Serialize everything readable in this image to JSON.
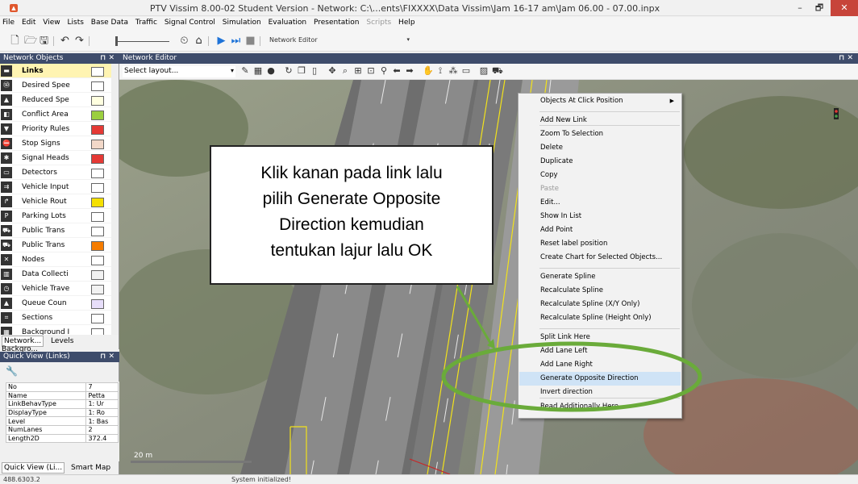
{
  "window": {
    "title": "PTV Vissim 8.00-02 Student Version - Network: C:\\...ents\\FIXXXX\\Data Vissim\\Jam 16-17 am\\Jam 06.00 - 07.00.inpx",
    "app_icon": "vissim-logo-icon",
    "minimize": "–",
    "maximize": "🗗",
    "close": "✕"
  },
  "menubar": {
    "items": [
      "File",
      "Edit",
      "View",
      "Lists",
      "Base Data",
      "Traffic",
      "Signal Control",
      "Simulation",
      "Evaluation",
      "Presentation",
      "Scripts",
      "Help"
    ]
  },
  "toolbar": {
    "editor_select": "Network Editor",
    "caret": "▾"
  },
  "network_objects": {
    "title": "Network Objects",
    "controls": "⊓ ✕",
    "colors": {
      "selected_row": "#fff4b2"
    },
    "items": [
      {
        "label": "Links",
        "bold": true,
        "swatch": "#ffffff"
      },
      {
        "label": "Desired Spee",
        "bold": false,
        "swatch": "#ffffff"
      },
      {
        "label": "Reduced Spe",
        "bold": false,
        "swatch": "#ffffe0"
      },
      {
        "label": "Conflict Area",
        "bold": false,
        "swatch": "#9bcf3f"
      },
      {
        "label": "Priority Rules",
        "bold": false,
        "swatch": "#e53935"
      },
      {
        "label": "Stop Signs",
        "bold": false,
        "swatch": "#f2d8c8"
      },
      {
        "label": "Signal Heads",
        "bold": false,
        "swatch": "#e53935"
      },
      {
        "label": "Detectors",
        "bold": false,
        "swatch": "#ffffff"
      },
      {
        "label": "Vehicle Input",
        "bold": false,
        "swatch": "#ffffff"
      },
      {
        "label": "Vehicle Rout",
        "bold": false,
        "swatch": "#f5e000"
      },
      {
        "label": "Parking Lots",
        "bold": false,
        "swatch": "#ffffff"
      },
      {
        "label": "Public Trans",
        "bold": false,
        "swatch": "#ffffff"
      },
      {
        "label": "Public Trans",
        "bold": false,
        "swatch": "#f57c00"
      },
      {
        "label": "Nodes",
        "bold": false,
        "swatch": "#ffffff"
      },
      {
        "label": "Data Collecti",
        "bold": false,
        "swatch": "#f2f2f2"
      },
      {
        "label": "Vehicle Trave",
        "bold": false,
        "swatch": "#f2f2f2"
      },
      {
        "label": "Queue Coun",
        "bold": false,
        "swatch": "#e7defa"
      },
      {
        "label": "Sections",
        "bold": false,
        "swatch": "#ffffff"
      },
      {
        "label": "Background I",
        "bold": false,
        "swatch": "#ffffff"
      }
    ],
    "tabs": [
      "Network...",
      "Levels",
      "Backgro..."
    ]
  },
  "quick_view": {
    "title": "Quick View (Links)",
    "controls": "⊓ ✕",
    "wrench": "🔧",
    "rows": [
      {
        "key": "No",
        "value": "7"
      },
      {
        "key": "Name",
        "value": "Petta"
      },
      {
        "key": "LinkBehavType",
        "value": "1: Ur"
      },
      {
        "key": "DisplayType",
        "value": "1: Ro"
      },
      {
        "key": "Level",
        "value": "1: Bas"
      },
      {
        "key": "NumLanes",
        "value": "2"
      },
      {
        "key": "Length2D",
        "value": "372.4"
      }
    ],
    "tabs": [
      "Quick View (Li...",
      "Smart Map"
    ]
  },
  "network_editor": {
    "title": "Network Editor",
    "controls": "⊓ ✕",
    "layout_select": "Select layout...",
    "scale_label": "20 m"
  },
  "callout": {
    "lines": [
      "Klik kanan pada link lalu",
      "pilih Generate Opposite",
      "Direction kemudian",
      "tentukan lajur lalu OK"
    ]
  },
  "context_menu": {
    "items": [
      {
        "label": "Objects At Click Position",
        "submenu": true
      },
      {
        "label": "Add New Link"
      },
      {
        "label": "Zoom To Selection"
      },
      {
        "label": "Delete"
      },
      {
        "label": "Duplicate"
      },
      {
        "label": "Copy"
      },
      {
        "label": "Paste",
        "disabled": true
      },
      {
        "label": "Edit..."
      },
      {
        "label": "Show In List"
      },
      {
        "label": "Add Point"
      },
      {
        "label": "Reset label position"
      },
      {
        "label": "Create Chart for Selected Objects..."
      },
      {
        "label": "Generate Spline"
      },
      {
        "label": "Recalculate Spline"
      },
      {
        "label": "Recalculate Spline (X/Y Only)"
      },
      {
        "label": "Recalculate Spline (Height Only)"
      },
      {
        "label": "Split Link Here"
      },
      {
        "label": "Add Lane Left"
      },
      {
        "label": "Add Lane Right"
      },
      {
        "label": "Generate Opposite Direction",
        "highlighted": true
      },
      {
        "label": "Invert direction"
      },
      {
        "label": "Read Additionally Here..."
      }
    ],
    "colors": {
      "highlight": "#cfe3f6",
      "ellipse": "#6aab3a"
    }
  },
  "statusbar": {
    "coords": "488.6303.2",
    "message": "System initialized!"
  }
}
